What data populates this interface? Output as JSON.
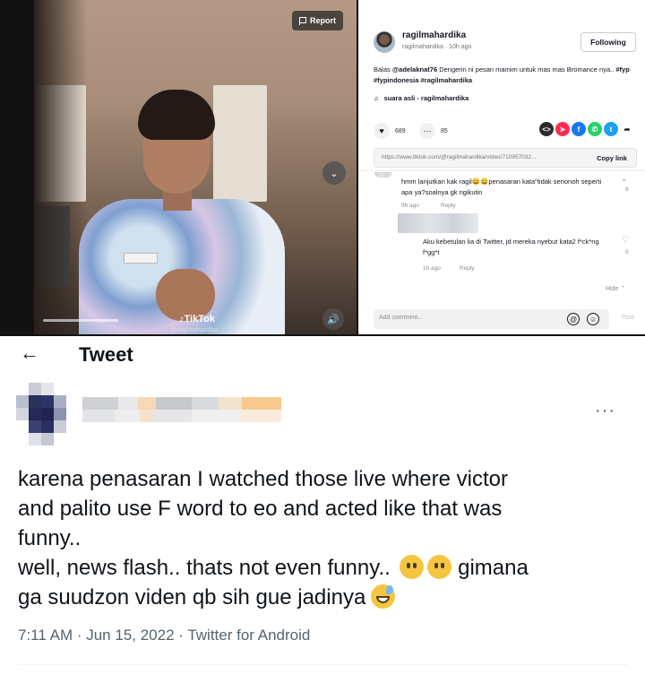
{
  "tiktok": {
    "report_label": "Report",
    "watermark_logo": "TikTok",
    "watermark_handle": "@ragilmahardika",
    "username": "ragilmahardika",
    "subline": "ragilmahardika · 10h ago",
    "follow_label": "Following",
    "caption_prefix": "Balas ",
    "caption_mention": "@adelaknat76",
    "caption_body": " Dengerin ni pesan mamim untuk mas mas Bromance nya.. ",
    "caption_tags": "#fyp #fypindonesia #ragilmahardika",
    "music": "suara asli - ragilmahardika",
    "likes": "689",
    "comments": "85",
    "link": "https://www.tiktok.com/@ragilmahardika/video/710957032...",
    "copy_label": "Copy link",
    "comment1_text": "hmm lanjutkan kak ragil😀😀penasaran kata\"tidak senonoh seperti apa ya?soalnya gk ngikutin",
    "comment1_time": "9h ago",
    "comment1_reply": "Reply",
    "comment1_likes": "8",
    "reply1_text": "Aku kebetulan lia di Twitter, jd mereka nyebut kata2 f*ck*ng f*gg*t",
    "reply1_time": "1h ago",
    "reply1_reply": "Reply",
    "reply1_likes": "0",
    "hide_label": "Hide ⌃",
    "add_comment_placeholder": "Add comment...",
    "post_label": "Post",
    "share_colors": [
      "#2b2b2b",
      "#fe2c55",
      "#1877f2",
      "#25d366",
      "#1da1f2"
    ]
  },
  "tweet": {
    "header_title": "Tweet",
    "back_icon": "arrow-left-icon",
    "more_icon": "more-icon",
    "line1": "karena penasaran I watched those live where victor",
    "line2": "and palito use F word to eo and acted like that was",
    "line3": "funny..",
    "line4": "well, news flash.. thats not even funny..",
    "line4_end": " gimana",
    "line5": "ga suudzon viden qb sih gue jadinya",
    "timestamp": "7:11 AM · Jun 15, 2022 · Twitter for Android"
  }
}
